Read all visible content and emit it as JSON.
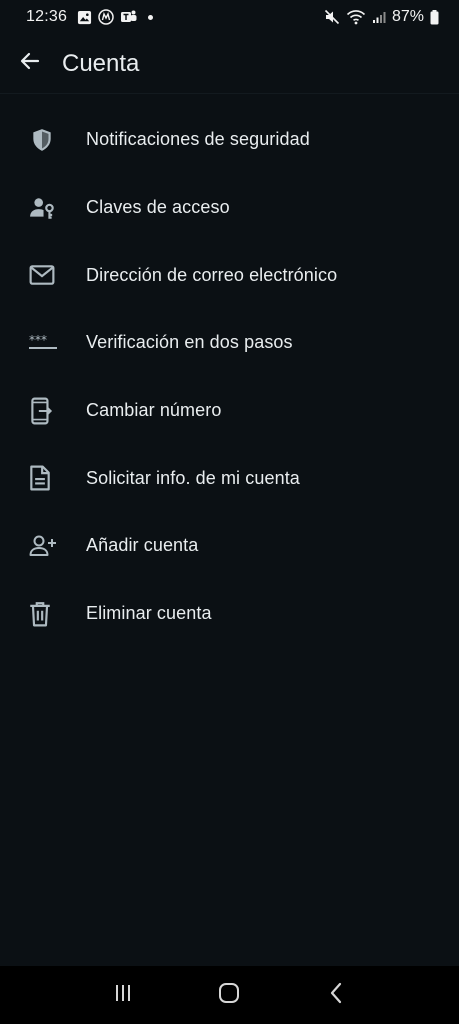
{
  "status_bar": {
    "time": "12:36",
    "battery": "87%",
    "left_icons": [
      "gallery-icon",
      "motorola-icon",
      "teams-icon",
      "notification-dot"
    ],
    "right_icons": [
      "mute-icon",
      "wifi-icon",
      "signal-icon",
      "battery-icon"
    ]
  },
  "app_bar": {
    "title": "Cuenta",
    "back_icon": "arrow-left-icon"
  },
  "settings": {
    "items": [
      {
        "label": "Notificaciones de seguridad",
        "icon": "shield-icon"
      },
      {
        "label": "Claves de acceso",
        "icon": "passkey-icon"
      },
      {
        "label": "Dirección de correo electrónico",
        "icon": "mail-icon"
      },
      {
        "label": "Verificación en dos pasos",
        "icon": "password-dots-icon"
      },
      {
        "label": "Cambiar número",
        "icon": "phone-change-icon"
      },
      {
        "label": "Solicitar info. de mi cuenta",
        "icon": "document-icon"
      },
      {
        "label": "Añadir cuenta",
        "icon": "person-add-icon"
      },
      {
        "label": "Eliminar cuenta",
        "icon": "trash-icon"
      }
    ]
  },
  "nav_bar": {
    "buttons": [
      "recent-apps-icon",
      "home-icon",
      "back-icon"
    ]
  },
  "colors": {
    "background": "#0b1014",
    "text": "#e9edef",
    "icon": "#aebac1"
  }
}
